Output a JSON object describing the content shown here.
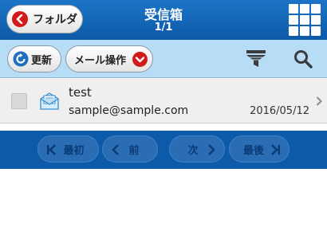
{
  "header": {
    "back_label": "フォルダ",
    "title": "受信箱",
    "page_indicator": "1/1"
  },
  "toolbar": {
    "refresh_label": "更新",
    "mail_ops_label": "メール操作"
  },
  "messages": [
    {
      "subject": "test",
      "sender": "sample@sample.com",
      "date": "2016/05/12",
      "checked": false
    }
  ],
  "pager": {
    "first_label": "最初",
    "prev_label": "前",
    "next_label": "次",
    "last_label": "最後"
  },
  "colors": {
    "header_blue": "#0d5aa8",
    "toolbar_light_blue": "#b7dcf5",
    "accent_red": "#d21a1a"
  },
  "icons": {
    "back": "chevron-left-icon",
    "menu": "grid-menu-icon",
    "refresh": "refresh-icon",
    "dropdown": "chevron-down-icon",
    "filter": "filter-icon",
    "search": "search-icon",
    "mail": "open-envelope-icon"
  }
}
